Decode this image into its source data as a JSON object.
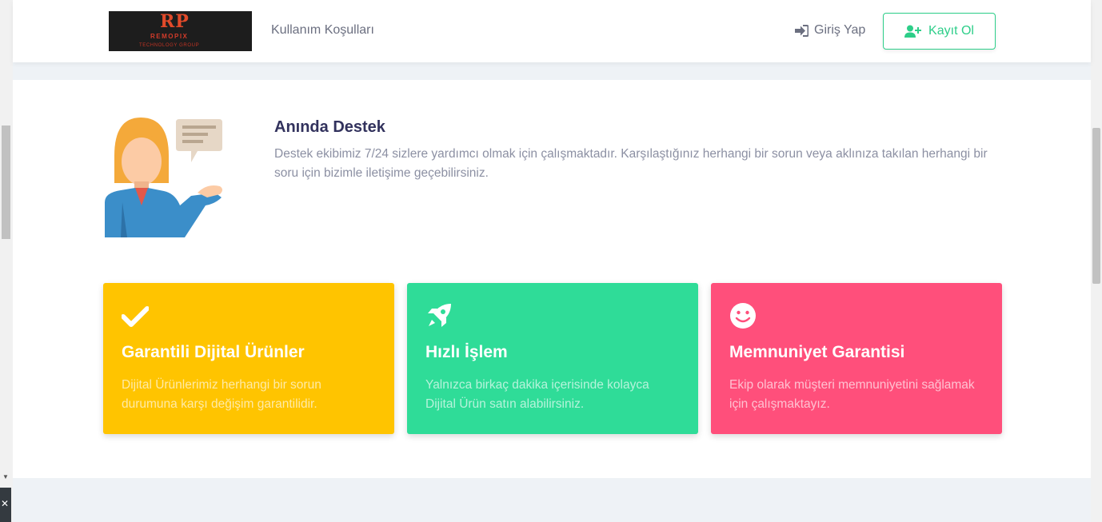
{
  "header": {
    "logo": {
      "initials": "RP",
      "name": "REMOPIX",
      "tagline": "TECHNOLOGY GROUP"
    },
    "nav_link": "Kullanım Koşulları",
    "login_label": "Giriş Yap",
    "register_label": "Kayıt Ol"
  },
  "support": {
    "title": "Anında Destek",
    "text": "Destek ekibimiz 7/24 sizlere yardımcı olmak için çalışmaktadır. Karşılaştığınız herhangi bir sorun veya aklınıza takılan herhangi bir soru için bizimle iletişime geçebilirsiniz."
  },
  "features": [
    {
      "icon": "check-icon",
      "title": "Garantili Dijital Ürünler",
      "text": "Dijital Ürünlerimiz herhangi bir sorun durumuna karşı değişim garantilidir.",
      "color": "#ffc400"
    },
    {
      "icon": "rocket-icon",
      "title": "Hızlı İşlem",
      "text": "Yalnızca birkaç dakika içerisinde kolayca Dijital Ürün satın alabilirsiniz.",
      "color": "#2fdc98"
    },
    {
      "icon": "smile-icon",
      "title": "Memnuniyet Garantisi",
      "text": "Ekip olarak müşteri memnuniyetini sağlamak için çalışmaktayız.",
      "color": "#ff4f7b"
    }
  ],
  "colors": {
    "accent": "#2dce89",
    "text_muted": "#8c90a3",
    "heading": "#32325d"
  }
}
